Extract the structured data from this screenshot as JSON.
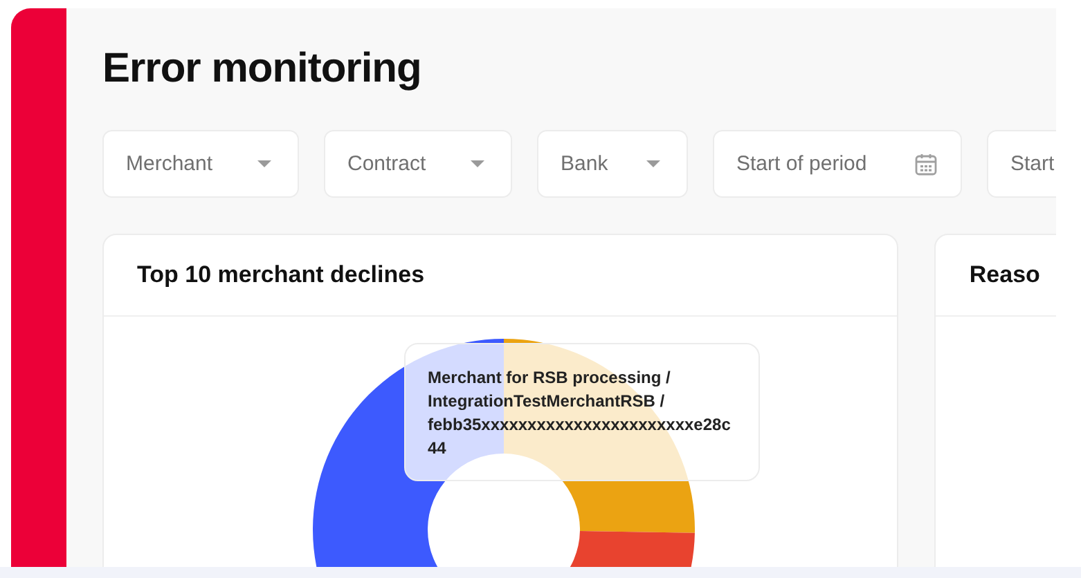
{
  "page": {
    "title": "Error monitoring"
  },
  "filters": [
    {
      "kind": "select",
      "label": "Merchant"
    },
    {
      "kind": "select",
      "label": "Contract"
    },
    {
      "kind": "select",
      "label": "Bank"
    },
    {
      "kind": "date",
      "label": "Start of period"
    },
    {
      "kind": "date",
      "label": "Start"
    }
  ],
  "cards": [
    {
      "title": "Top 10 merchant declines",
      "tooltip": "Merchant for RSB processing / IntegrationTestMerchantRSB / febb35xxxxxxxxxxxxxxxxxxxxxxxe28c44"
    },
    {
      "title": "Reaso"
    }
  ]
}
